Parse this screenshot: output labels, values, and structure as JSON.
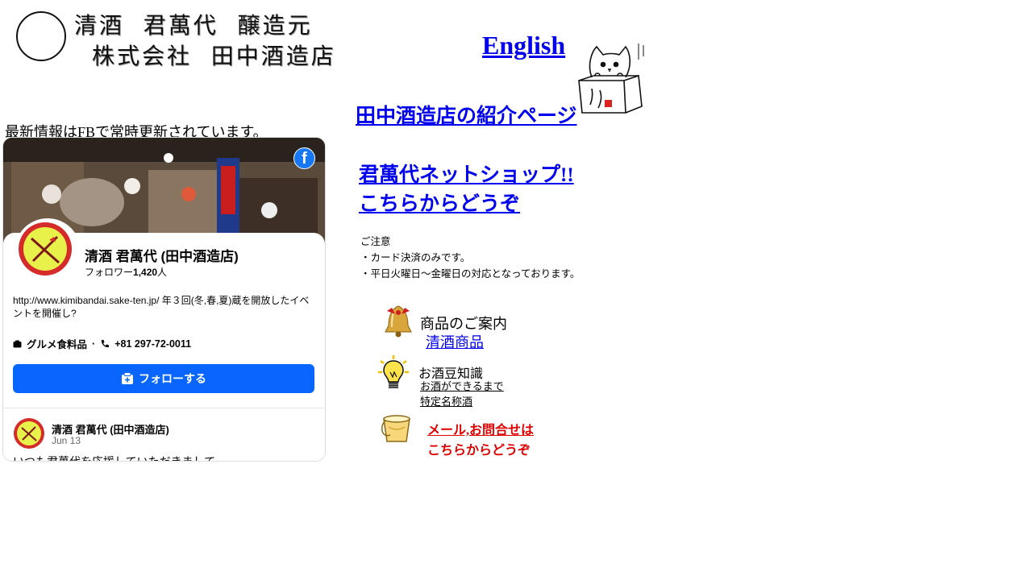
{
  "header": {
    "logo_line1": "清酒  君萬代  醸造元",
    "logo_line2": "株式会社  田中酒造店",
    "english_link": "English",
    "intro_link": "田中酒造店の紹介ページ"
  },
  "fb_note": "最新情報はFBで常時更新されています。",
  "facebook": {
    "page_name": "清酒 君萬代 (田中酒造店)",
    "followers_prefix": "フォロワー",
    "followers_count": "1,420",
    "followers_suffix": "人",
    "about": "http://www.kimibandai.sake-ten.jp/ 年３回(冬,春,夏)蔵を開放したイベントを開催し?",
    "category": "グルメ食料品",
    "separator": "·",
    "phone": "+81 297-72-0011",
    "follow_button": "フォローする",
    "post": {
      "author": "清酒 君萬代 (田中酒造店)",
      "date": "Jun 13",
      "text": "いつも君萬代を応援していただきまして"
    },
    "brand_color": "#0866ff"
  },
  "shop": {
    "line1": "君萬代ネットショップ!!",
    "line2": "こちらからどうぞ"
  },
  "notice": {
    "title": "ご注意",
    "line1": "・カード決済のみです。",
    "line2": "・平日火曜日～金曜日の対応となっております。"
  },
  "menu": {
    "products_heading": "商品のご案内",
    "products_link": "清酒商品",
    "knowledge_heading": "お酒豆知識",
    "knowledge_link1": "お酒ができるまで",
    "knowledge_link2": "特定名称酒",
    "contact_line1": "メール,お問合せは",
    "contact_line2": "こちらからどうぞ"
  }
}
